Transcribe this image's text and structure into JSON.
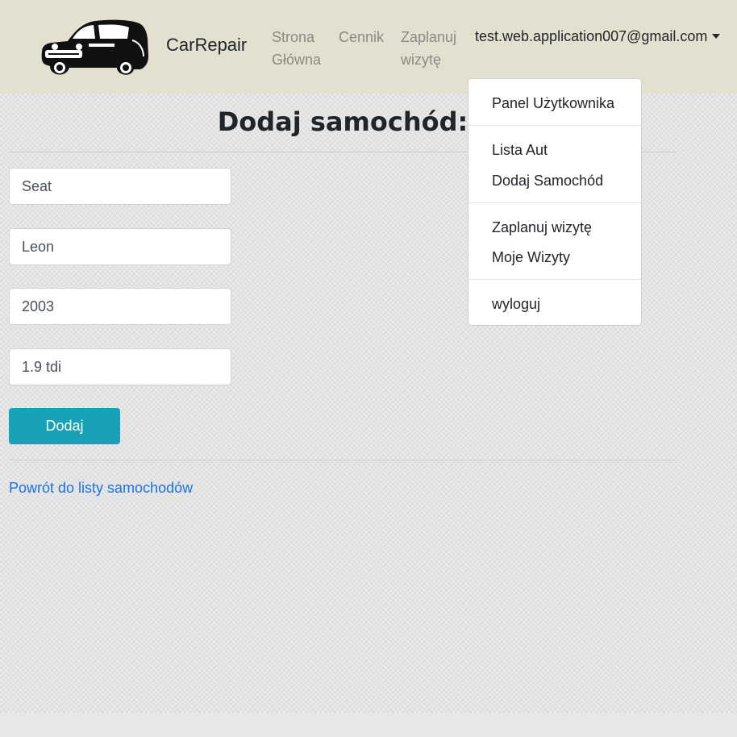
{
  "navbar": {
    "brand": "CarRepair",
    "links": [
      "Strona Główna",
      "Cennik",
      "Zaplanuj wizytę"
    ],
    "user_email": "test.web.application007@gmail.com",
    "logo_icon": "car-icon"
  },
  "dropdown": {
    "items": [
      "Panel Użytkownika",
      "Lista Aut",
      "Dodaj Samochód",
      "Zaplanuj wizytę",
      "Moje Wizyty",
      "wyloguj"
    ]
  },
  "form": {
    "title": "Dodaj samochód:",
    "fields": [
      {
        "value": "Seat"
      },
      {
        "value": "Leon"
      },
      {
        "value": "2003"
      },
      {
        "value": "1.9 tdi"
      }
    ],
    "submit_label": "Dodaj",
    "back_link": "Powrót do listy samochodów"
  },
  "colors": {
    "navbar_bg": "#e3e0cf",
    "button": "#17a2b8",
    "link": "#1a73e8"
  }
}
